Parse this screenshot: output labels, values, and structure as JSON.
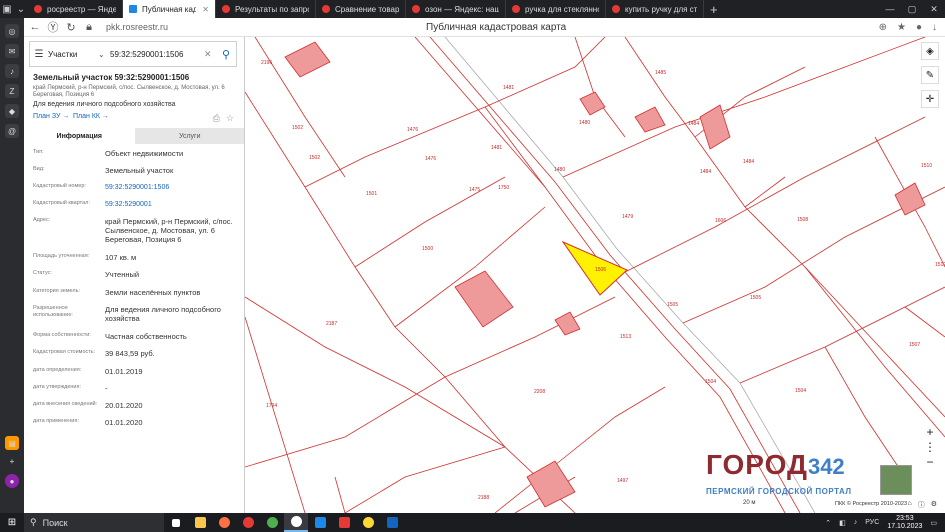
{
  "browser": {
    "tabs": [
      {
        "label": "росреестр — Яндекс: наш",
        "active": false
      },
      {
        "label": "Публичная кадастрова",
        "active": true
      },
      {
        "label": "Результаты по запросу «р",
        "active": false
      },
      {
        "label": "Сравнение товаров - Мар",
        "active": false
      },
      {
        "label": "озон — Яндекс: нашлось",
        "active": false
      },
      {
        "label": "ручка для стеклянной кр",
        "active": false
      },
      {
        "label": "купить ручку для стекляг",
        "active": false
      }
    ],
    "url": "pkk.rosreestr.ru",
    "page_title": "Публичная кадастровая карта"
  },
  "search": {
    "type": "Участки",
    "value": "59:32:5290001:1506"
  },
  "parcel": {
    "title": "Земельный участок 59:32:5290001:1506",
    "address_short": "край Пермский, р-н Пермский, с/пос. Сылвенское, д. Мостовая, ул. 6 Береговая, Позиция 6",
    "use": "Для ведения личного подсобного хозяйства",
    "plan_zu": "План ЗУ",
    "plan_kk": "План КК"
  },
  "tabs": {
    "info": "Информация",
    "services": "Услуги"
  },
  "fields": [
    {
      "label": "Тип:",
      "value": "Объект недвижимости",
      "link": false
    },
    {
      "label": "Вид:",
      "value": "Земельный участок",
      "link": false
    },
    {
      "label": "Кадастровый номер:",
      "value": "59:32:5290001:1506",
      "link": true
    },
    {
      "label": "Кадастровый квартал:",
      "value": "59:32:5290001",
      "link": true
    },
    {
      "label": "Адрес:",
      "value": "край Пермский, р-н Пермский, с/пос. Сылвенское, д. Мостовая, ул. 6 Береговая, Позиция 6",
      "link": false
    },
    {
      "label": "Площадь уточненная:",
      "value": "107 кв. м",
      "link": false
    },
    {
      "label": "Статус:",
      "value": "Учтенный",
      "link": false
    },
    {
      "label": "Категория земель:",
      "value": "Земли населённых пунктов",
      "link": false
    },
    {
      "label": "Разрешенное использование:",
      "value": "Для ведения личного подсобного хозяйства",
      "link": false
    },
    {
      "label": "Форма собственности:",
      "value": "Частная собственность",
      "link": false
    },
    {
      "label": "Кадастровая стоимость:",
      "value": "39 843,59 руб.",
      "link": false
    },
    {
      "label": "дата определения:",
      "value": "01.01.2019",
      "link": false
    },
    {
      "label": "дата утверждения:",
      "value": "-",
      "link": false
    },
    {
      "label": "дата внесения сведений:",
      "value": "20.01.2020",
      "link": false
    },
    {
      "label": "дата применения:",
      "value": "01.01.2020",
      "link": false
    }
  ],
  "map_labels": [
    {
      "text": "2196"
    },
    {
      "text": "1481"
    },
    {
      "text": "1485"
    },
    {
      "text": "1480"
    },
    {
      "text": "1484"
    },
    {
      "text": "1502"
    },
    {
      "text": "1476"
    },
    {
      "text": "1481"
    },
    {
      "text": "1502"
    },
    {
      "text": "1476"
    },
    {
      "text": "1484"
    },
    {
      "text": "1510"
    },
    {
      "text": "1475"
    },
    {
      "text": "1750"
    },
    {
      "text": "1480"
    },
    {
      "text": "1484"
    },
    {
      "text": "1501"
    },
    {
      "text": "1479"
    },
    {
      "text": "1508"
    },
    {
      "text": "1500"
    },
    {
      "text": "1506"
    },
    {
      "text": "1505"
    },
    {
      "text": "1505"
    },
    {
      "text": "2187"
    },
    {
      "text": "1513"
    },
    {
      "text": "1507"
    },
    {
      "text": "1504"
    },
    {
      "text": "1504"
    },
    {
      "text": "2208"
    },
    {
      "text": "1794"
    },
    {
      "text": "2188"
    },
    {
      "text": "1497"
    },
    {
      "text": "1512"
    },
    {
      "text": "1606"
    }
  ],
  "logo": {
    "name": "ГОРОД",
    "number": "342",
    "subtitle": "ПЕРМСКИЙ ГОРОДСКОЙ ПОРТАЛ"
  },
  "map_footer": {
    "scale": "20 м",
    "copyright": "ПКК © Росреестр 2010-2023"
  },
  "taskbar": {
    "search": "Поиск",
    "lang": "РУС",
    "time": "23:53",
    "date": "17.10.2023"
  },
  "colors": {
    "parcel_line": "#d32f2f",
    "selected_fill": "#fff200",
    "accent": "#1565c0"
  }
}
